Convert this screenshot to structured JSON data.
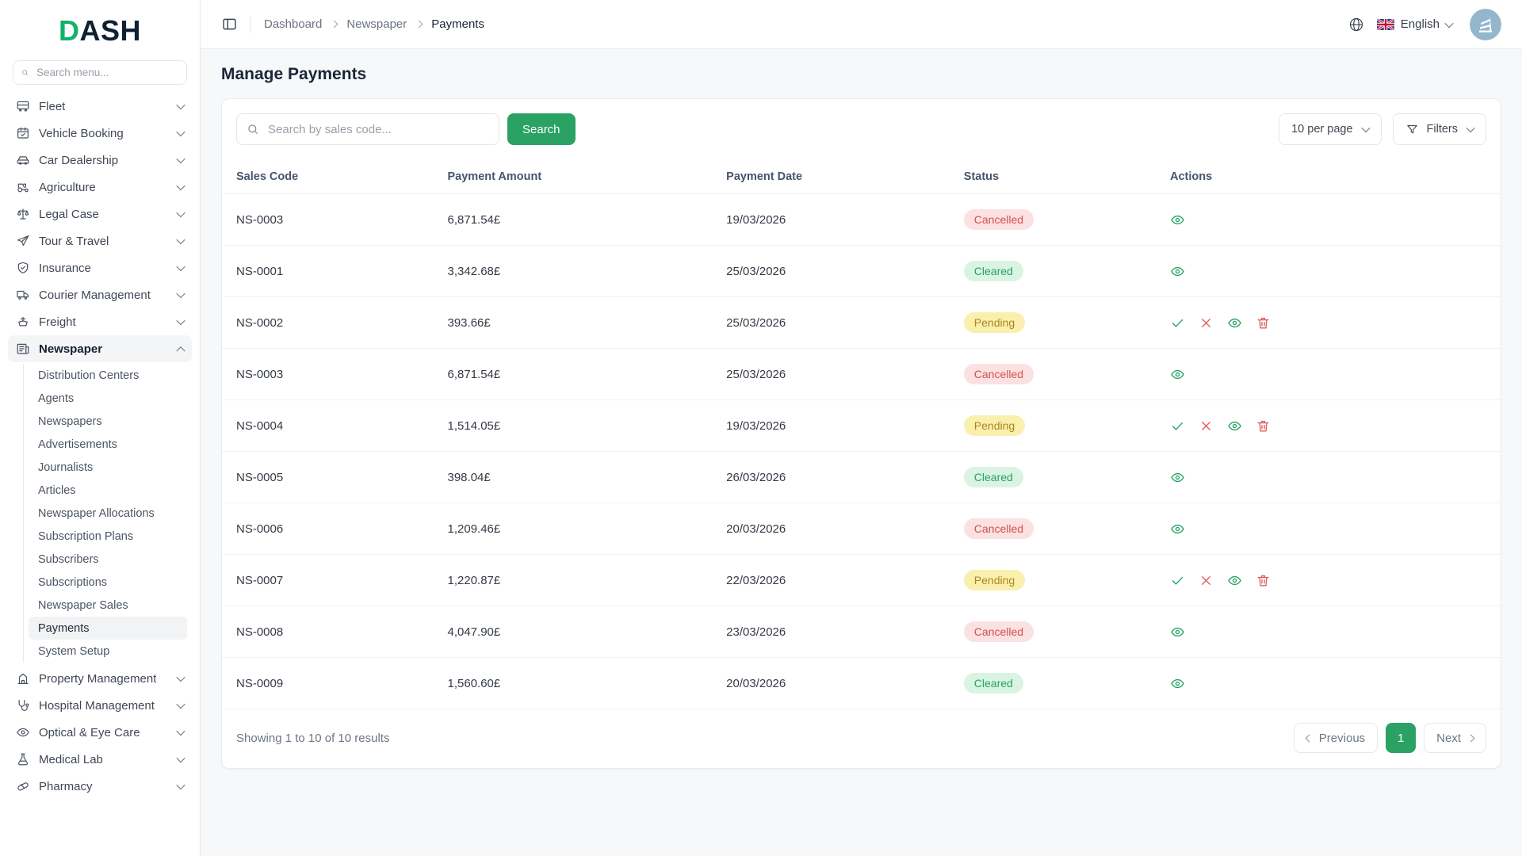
{
  "brand": {
    "d": "D",
    "ash": "ASH"
  },
  "sidebar": {
    "search_placeholder": "Search menu...",
    "items": [
      {
        "label": "Fleet",
        "icon": "bus-icon"
      },
      {
        "label": "Vehicle Booking",
        "icon": "calendar-check-icon"
      },
      {
        "label": "Car Dealership",
        "icon": "car-icon"
      },
      {
        "label": "Agriculture",
        "icon": "tractor-icon"
      },
      {
        "label": "Legal Case",
        "icon": "scales-icon"
      },
      {
        "label": "Tour & Travel",
        "icon": "paper-plane-icon"
      },
      {
        "label": "Insurance",
        "icon": "shield-check-icon"
      },
      {
        "label": "Courier Management",
        "icon": "delivery-truck-icon"
      },
      {
        "label": "Freight",
        "icon": "ship-icon"
      },
      {
        "label": "Newspaper",
        "icon": "newspaper-icon"
      },
      {
        "label": "Property Management",
        "icon": "property-icon"
      },
      {
        "label": "Hospital Management",
        "icon": "stethoscope-icon"
      },
      {
        "label": "Optical & Eye Care",
        "icon": "eye-icon"
      },
      {
        "label": "Medical Lab",
        "icon": "flask-icon"
      },
      {
        "label": "Pharmacy",
        "icon": "pill-icon"
      }
    ],
    "sub_items": [
      "Distribution Centers",
      "Agents",
      "Newspapers",
      "Advertisements",
      "Journalists",
      "Articles",
      "Newspaper Allocations",
      "Subscription Plans",
      "Subscribers",
      "Subscriptions",
      "Newspaper Sales",
      "Payments",
      "System Setup"
    ],
    "active_item": "Newspaper",
    "active_sub_item": "Payments"
  },
  "topbar": {
    "breadcrumb": [
      "Dashboard",
      "Newspaper",
      "Payments"
    ],
    "language": "English"
  },
  "page": {
    "title": "Manage Payments"
  },
  "toolbar": {
    "search_placeholder": "Search by sales code...",
    "search_button": "Search",
    "per_page": "10 per page",
    "filters": "Filters"
  },
  "table": {
    "headers": [
      "Sales Code",
      "Payment Amount",
      "Payment Date",
      "Status",
      "Actions"
    ],
    "rows": [
      {
        "sales_code": "NS-0003",
        "amount": "6,871.54£",
        "date": "19/03/2026",
        "status": "Cancelled"
      },
      {
        "sales_code": "NS-0001",
        "amount": "3,342.68£",
        "date": "25/03/2026",
        "status": "Cleared"
      },
      {
        "sales_code": "NS-0002",
        "amount": "393.66£",
        "date": "25/03/2026",
        "status": "Pending"
      },
      {
        "sales_code": "NS-0003",
        "amount": "6,871.54£",
        "date": "25/03/2026",
        "status": "Cancelled"
      },
      {
        "sales_code": "NS-0004",
        "amount": "1,514.05£",
        "date": "19/03/2026",
        "status": "Pending"
      },
      {
        "sales_code": "NS-0005",
        "amount": "398.04£",
        "date": "26/03/2026",
        "status": "Cleared"
      },
      {
        "sales_code": "NS-0006",
        "amount": "1,209.46£",
        "date": "20/03/2026",
        "status": "Cancelled"
      },
      {
        "sales_code": "NS-0007",
        "amount": "1,220.87£",
        "date": "22/03/2026",
        "status": "Pending"
      },
      {
        "sales_code": "NS-0008",
        "amount": "4,047.90£",
        "date": "23/03/2026",
        "status": "Cancelled"
      },
      {
        "sales_code": "NS-0009",
        "amount": "1,560.60£",
        "date": "20/03/2026",
        "status": "Cleared"
      }
    ]
  },
  "pagination": {
    "summary": "Showing 1 to 10 of 10 results",
    "previous": "Previous",
    "page": "1",
    "next": "Next"
  },
  "colors": {
    "accent_green": "#2aa263",
    "logo_green": "#10b369",
    "logo_navy": "#0d2133",
    "cancelled_bg": "#fbe1e1",
    "cancelled_text": "#d4504c",
    "cleared_bg": "#d9f4e3",
    "cleared_text": "#27a165",
    "pending_bg": "#faf0ad",
    "pending_text": "#ad851e"
  }
}
